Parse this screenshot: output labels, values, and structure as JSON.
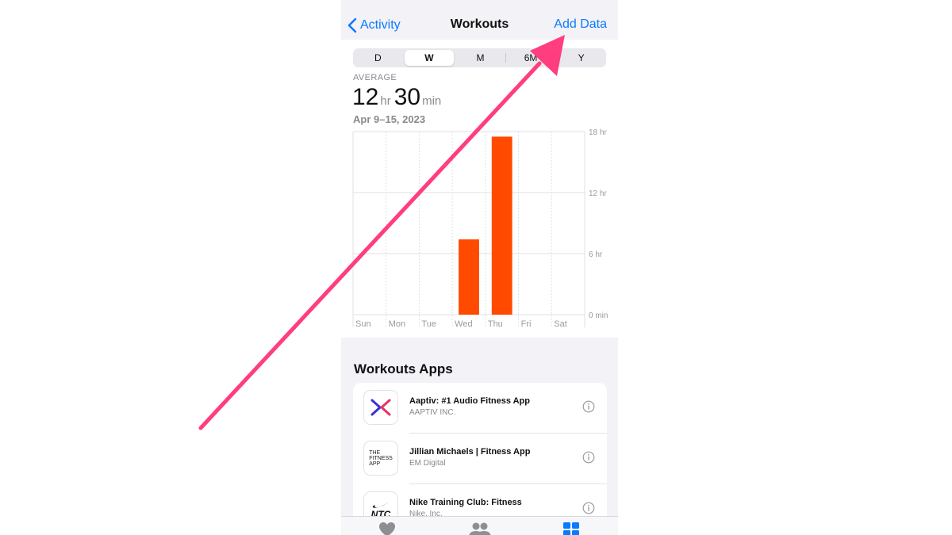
{
  "nav": {
    "back_label": "Activity",
    "title": "Workouts",
    "action_label": "Add Data"
  },
  "range": {
    "options": [
      "D",
      "W",
      "M",
      "6M",
      "Y"
    ],
    "selected": "W"
  },
  "summary": {
    "label": "AVERAGE",
    "hours_value": "12",
    "hours_unit": "hr",
    "minutes_value": "30",
    "minutes_unit": "min",
    "date_range": "Apr 9–15, 2023"
  },
  "chart_data": {
    "type": "bar",
    "categories": [
      "Sun",
      "Mon",
      "Tue",
      "Wed",
      "Thu",
      "Fri",
      "Sat"
    ],
    "values": [
      0,
      0,
      0,
      7.4,
      17.5,
      0,
      0
    ],
    "ylim": [
      0,
      18
    ],
    "yticks": [
      0,
      6,
      12,
      18
    ],
    "ytick_labels": [
      "0 min",
      "6 hr",
      "12 hr",
      "18 hr"
    ],
    "bar_color": "#ff4a00",
    "grid": true
  },
  "apps": {
    "title": "Workouts Apps",
    "items": [
      {
        "name": "Aaptiv: #1 Audio Fitness App",
        "developer": "AAPTIV INC."
      },
      {
        "name": "Jillian Michaels | Fitness App",
        "developer": "EM Digital"
      },
      {
        "name": "Nike Training Club: Fitness",
        "developer": "Nike, Inc."
      }
    ],
    "icon_texts": {
      "fitness_app": [
        "THE",
        "FITNESS",
        "APP"
      ],
      "ntc": "NTC"
    }
  },
  "tabs": [
    "heart-icon",
    "sharing-icon",
    "browse-icon"
  ],
  "colors": {
    "accent": "#0a7aff",
    "bar": "#ff4a00",
    "annotation_arrow": "#ff3d7f"
  }
}
